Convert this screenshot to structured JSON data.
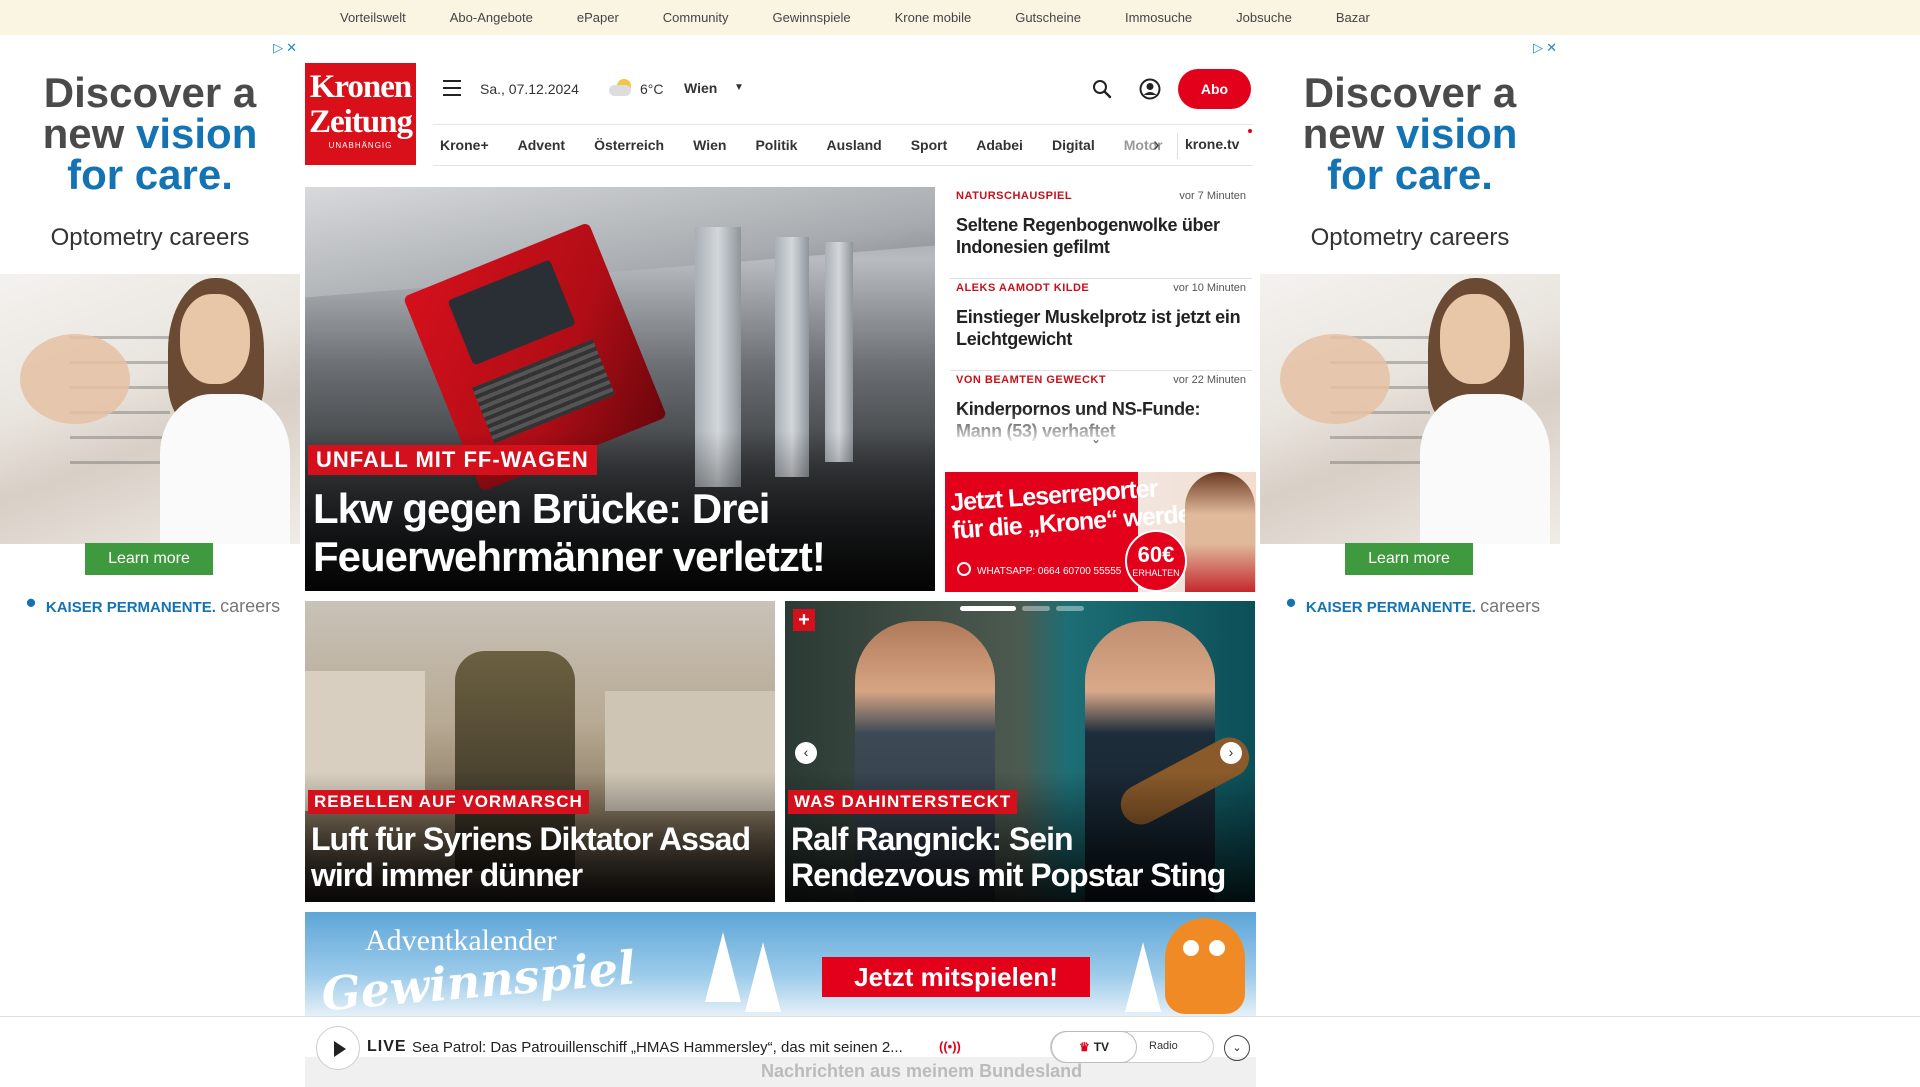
{
  "topbar": {
    "items": [
      "Vorteilswelt",
      "Abo-Angebote",
      "ePaper",
      "Community",
      "Gewinnspiele",
      "Krone mobile",
      "Gutscheine",
      "Immosuche",
      "Jobsuche",
      "Bazar"
    ]
  },
  "ad": {
    "line1": "Discover a",
    "line2a": "new ",
    "line2b": "vision",
    "line3": "for care.",
    "sub": "Optometry careers",
    "cta": "Learn more",
    "brand": "KAISER PERMANENTE.",
    "brand_suffix": "careers",
    "close": "▷✕"
  },
  "header": {
    "logo_line1": "Kronen",
    "logo_line2": "Zeitung",
    "logo_tagline": "UNABHÄNGIG",
    "date": "Sa., 07.12.2024",
    "temperature": "6°C",
    "city": "Wien",
    "city_chevron": "▼",
    "abo_label": "Abo",
    "icons": {
      "menu": "menu-icon",
      "weather": "partly-cloudy-icon",
      "search": "search-icon",
      "user": "user-account-icon"
    }
  },
  "nav": {
    "items": [
      "Krone+",
      "Advent",
      "Österreich",
      "Wien",
      "Politik",
      "Ausland",
      "Sport",
      "Adabei",
      "Digital"
    ],
    "faded_item": "Motor",
    "arrow": "›",
    "tv_label": "krone.tv"
  },
  "hero": {
    "kicker": "UNFALL MIT FF-WAGEN",
    "title": "Lkw gegen Brücke: Drei Feuerwehrmänner verletzt!"
  },
  "side_news": [
    {
      "kicker": "NATURSCHAUSPIEL",
      "time": "vor 7 Minuten",
      "headline": "Seltene Regenbogenwolke über Indonesien gefilmt"
    },
    {
      "kicker": "ALEKS AAMODT KILDE",
      "time": "vor 10 Minuten",
      "headline": "Einstieger Muskelprotz ist jetzt ein Leichtgewicht"
    },
    {
      "kicker": "VON BEAMTEN GEWECKT",
      "time": "vor 22 Minuten",
      "headline": "Kinderpornos und NS-Funde: Mann (53) verhaftet"
    }
  ],
  "side_chevron": "⌄",
  "promo": {
    "line1": "Jetzt Leserreporter",
    "line2": "für die „Krone“ werden",
    "whatsapp": "WHATSAPP: 0664 60700 55555",
    "badge_amount": "60€",
    "badge_label": "ERHALTEN"
  },
  "teasers": [
    {
      "kicker": "REBELLEN AUF VORMARSCH",
      "title": "Luft für Syriens Diktator Assad wird immer dünner"
    },
    {
      "kicker": "WAS DAHINTERSTECKT",
      "title": "Ralf Rangnick: Sein Rendezvous mit Popstar Sting",
      "plus": "+",
      "prev": "‹",
      "next": "›"
    }
  ],
  "advent": {
    "line1": "Adventkalender",
    "line2": "Gewinnspiel",
    "cta": "Jetzt mitspielen!"
  },
  "player": {
    "live_label": "LIVE",
    "title": "Sea Patrol: Das Patrouillenschiff „HMAS Hammersley“, das mit seinen 2...",
    "radio_icon": "((•))",
    "tv_label": "TV",
    "tv_crown": "♛",
    "radio_label": "Radio",
    "expand": "⌄",
    "ghost_text": "Nachrichten aus meinem Bundesland"
  },
  "colors": {
    "brand_red": "#e2001a",
    "kicker_red": "#c8101a",
    "topbar_bg": "#faf5e3",
    "ad_blue": "#1473b3",
    "ad_green": "#3f9a3f"
  }
}
